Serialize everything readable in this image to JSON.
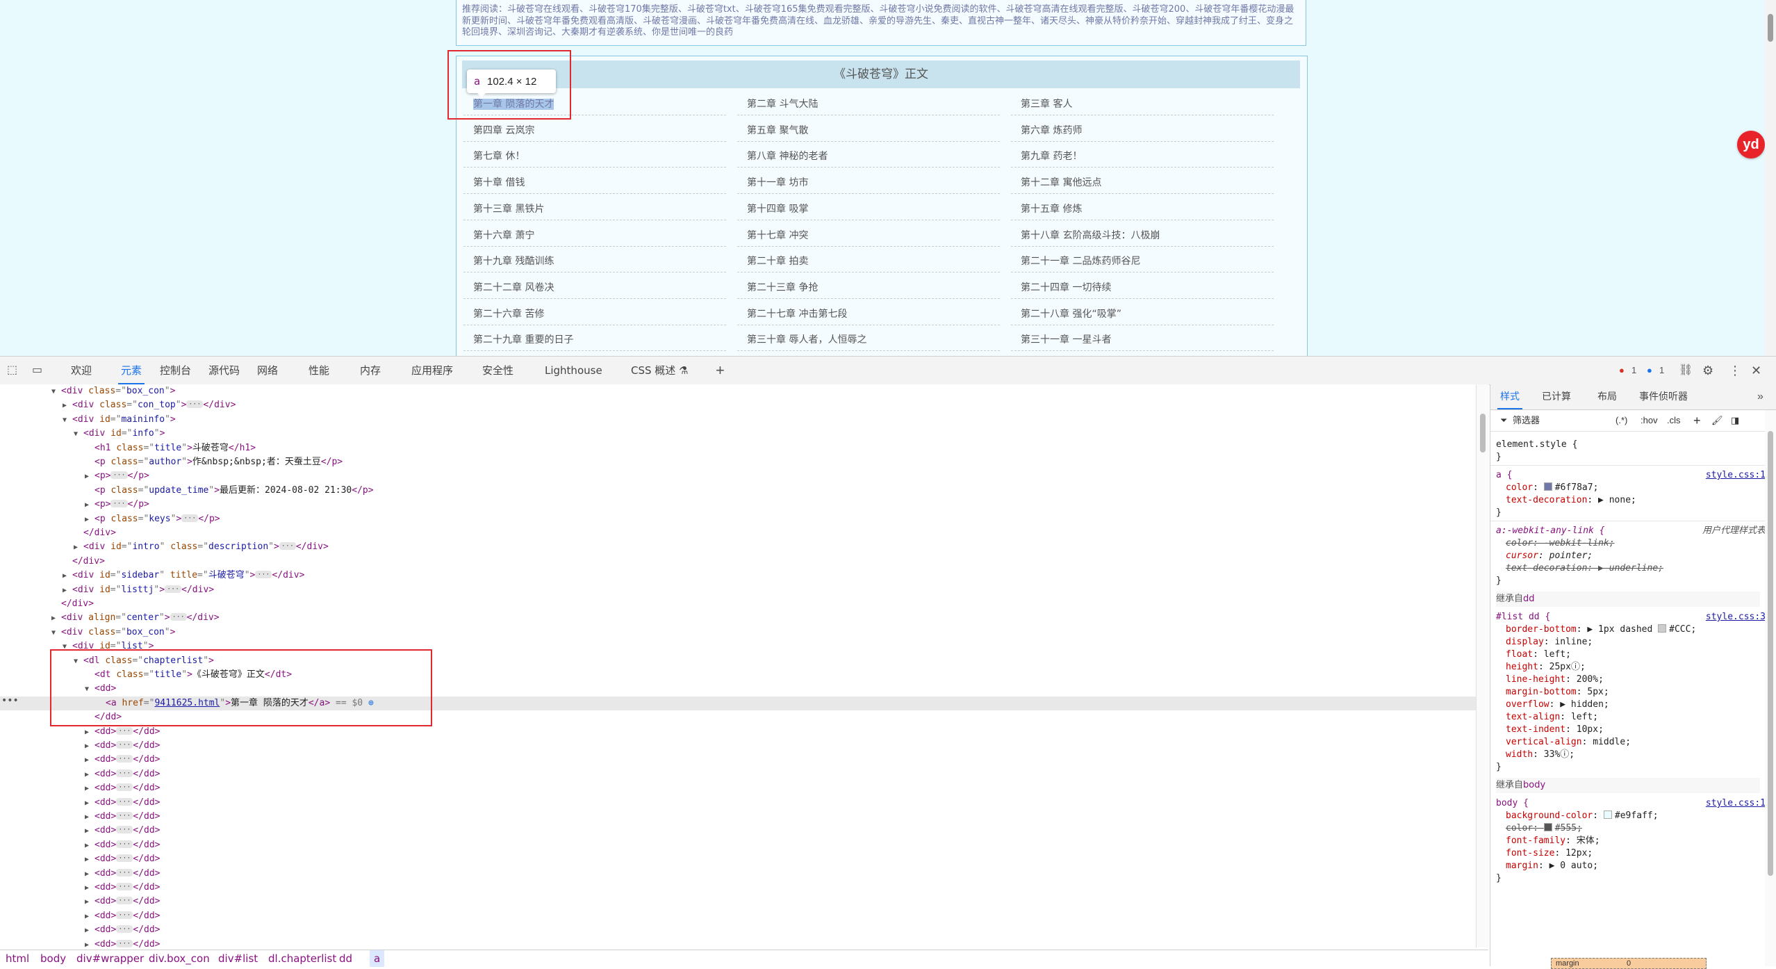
{
  "page": {
    "recommend_text": "推荐阅读：斗破苍穹在线观看、斗破苍穹170集完整版、斗破苍穹txt、斗破苍穹165集免费观看完整版、斗破苍穹小说免费阅读的软件、斗破苍穹高清在线观看完整版、斗破苍穹200、斗破苍穹年番樱花动漫最新更新时间、斗破苍穹年番免费观看高清版、斗破苍穹漫画、斗破苍穹年番免费高清在线、血龙骄雄、亲爱的导游先生、秦吏、直视古神一整年、诸天尽头、神豪从特价矜奈开始、穿越封神我成了纣王、变身之轮回境界、深圳咨询记、大秦期才有逆袭系统、你是世间唯一的良药",
    "list_title": "《斗破苍穹》正文",
    "chapters": [
      "第一章 陨落的天才",
      "第二章 斗气大陆",
      "第三章 客人",
      "第四章 云岚宗",
      "第五章 聚气散",
      "第六章 炼药师",
      "第七章 休！",
      "第八章 神秘的老者",
      "第九章 药老！",
      "第十章 借钱",
      "第十一章 坊市",
      "第十二章 寓他远点",
      "第十三章 黑铁片",
      "第十四章 吸掌",
      "第十五章 修炼",
      "第十六章 萧宁",
      "第十七章 冲突",
      "第十八章 玄阶高级斗技：八极崩",
      "第十九章 残酷训练",
      "第二十章 拍卖",
      "第二十一章 二品炼药师谷尼",
      "第二十二章 风卷决",
      "第二十三章 争抢",
      "第二十四章 一切待续",
      "第二十六章 苦修",
      "第二十七章 冲击第七段",
      "第二十八章 强化“吸掌”",
      "第二十九章 重要的日子",
      "第三十章 辱人者，人恒辱之",
      "第三十一章 一星斗者"
    ],
    "tooltip_tag": "a",
    "tooltip_dims": "102.4 × 12",
    "badge": "yd"
  },
  "devtools": {
    "tabs": [
      "欢迎",
      "元素",
      "控制台",
      "源代码",
      "网络",
      "性能",
      "内存",
      "应用程序",
      "安全性",
      "Lighthouse",
      "CSS 概述 ⚗"
    ],
    "active_tab": "元素",
    "error_count": "1",
    "info_count": "1",
    "dom_lines": [
      {
        "indent": 2,
        "tri": "▼",
        "html": [
          [
            "tg",
            "<div "
          ],
          [
            "an",
            "class"
          ],
          [
            "eq",
            "=\""
          ],
          [
            "av",
            "box_con"
          ],
          [
            "eq",
            "\""
          ],
          [
            "tg",
            ">"
          ]
        ]
      },
      {
        "indent": 3,
        "tri": "▶",
        "html": [
          [
            "tg",
            "<div "
          ],
          [
            "an",
            "class"
          ],
          [
            "eq",
            "=\""
          ],
          [
            "av",
            "con_top"
          ],
          [
            "eq",
            "\""
          ],
          [
            "tg",
            ">"
          ],
          [
            "ell",
            "···"
          ],
          [
            "tg",
            "</div>"
          ]
        ]
      },
      {
        "indent": 3,
        "tri": "▼",
        "html": [
          [
            "tg",
            "<div "
          ],
          [
            "an",
            "id"
          ],
          [
            "eq",
            "=\""
          ],
          [
            "av",
            "maininfo"
          ],
          [
            "eq",
            "\""
          ],
          [
            "tg",
            ">"
          ]
        ]
      },
      {
        "indent": 4,
        "tri": "▼",
        "html": [
          [
            "tg",
            "<div "
          ],
          [
            "an",
            "id"
          ],
          [
            "eq",
            "=\""
          ],
          [
            "av",
            "info"
          ],
          [
            "eq",
            "\""
          ],
          [
            "tg",
            ">"
          ]
        ]
      },
      {
        "indent": 5,
        "tri": "",
        "html": [
          [
            "tg",
            "<h1 "
          ],
          [
            "an",
            "class"
          ],
          [
            "eq",
            "=\""
          ],
          [
            "av",
            "title"
          ],
          [
            "eq",
            "\""
          ],
          [
            "tg",
            ">"
          ],
          [
            "tx",
            "斗破苍穹"
          ],
          [
            "tg",
            "</h1>"
          ]
        ]
      },
      {
        "indent": 5,
        "tri": "",
        "html": [
          [
            "tg",
            "<p "
          ],
          [
            "an",
            "class"
          ],
          [
            "eq",
            "=\""
          ],
          [
            "av",
            "author"
          ],
          [
            "eq",
            "\""
          ],
          [
            "tg",
            ">"
          ],
          [
            "tx",
            "作&nbsp;&nbsp;者：天蚕土豆"
          ],
          [
            "tg",
            "</p>"
          ]
        ]
      },
      {
        "indent": 5,
        "tri": "▶",
        "html": [
          [
            "tg",
            "<p>"
          ],
          [
            "ell",
            "···"
          ],
          [
            "tg",
            "</p>"
          ]
        ]
      },
      {
        "indent": 5,
        "tri": "",
        "html": [
          [
            "tg",
            "<p "
          ],
          [
            "an",
            "class"
          ],
          [
            "eq",
            "=\""
          ],
          [
            "av",
            "update_time"
          ],
          [
            "eq",
            "\""
          ],
          [
            "tg",
            ">"
          ],
          [
            "tx",
            "最后更新：2024-08-02 21:30"
          ],
          [
            "tg",
            "</p>"
          ]
        ]
      },
      {
        "indent": 5,
        "tri": "▶",
        "html": [
          [
            "tg",
            "<p>"
          ],
          [
            "ell",
            "···"
          ],
          [
            "tg",
            "</p>"
          ]
        ]
      },
      {
        "indent": 5,
        "tri": "▶",
        "html": [
          [
            "tg",
            "<p "
          ],
          [
            "an",
            "class"
          ],
          [
            "eq",
            "=\""
          ],
          [
            "av",
            "keys"
          ],
          [
            "eq",
            "\""
          ],
          [
            "tg",
            ">"
          ],
          [
            "ell",
            "···"
          ],
          [
            "tg",
            "</p>"
          ]
        ]
      },
      {
        "indent": 4,
        "tri": "",
        "html": [
          [
            "tg",
            "</div>"
          ]
        ]
      },
      {
        "indent": 4,
        "tri": "▶",
        "html": [
          [
            "tg",
            "<div "
          ],
          [
            "an",
            "id"
          ],
          [
            "eq",
            "=\""
          ],
          [
            "av",
            "intro"
          ],
          [
            "eq",
            "\" "
          ],
          [
            "an",
            "class"
          ],
          [
            "eq",
            "=\""
          ],
          [
            "av",
            "description"
          ],
          [
            "eq",
            "\""
          ],
          [
            "tg",
            ">"
          ],
          [
            "ell",
            "···"
          ],
          [
            "tg",
            "</div>"
          ]
        ]
      },
      {
        "indent": 3,
        "tri": "",
        "html": [
          [
            "tg",
            "</div>"
          ]
        ]
      },
      {
        "indent": 3,
        "tri": "▶",
        "html": [
          [
            "tg",
            "<div "
          ],
          [
            "an",
            "id"
          ],
          [
            "eq",
            "=\""
          ],
          [
            "av",
            "sidebar"
          ],
          [
            "eq",
            "\" "
          ],
          [
            "an",
            "title"
          ],
          [
            "eq",
            "=\""
          ],
          [
            "av",
            "斗破苍穹"
          ],
          [
            "eq",
            "\""
          ],
          [
            "tg",
            ">"
          ],
          [
            "ell",
            "···"
          ],
          [
            "tg",
            "</div>"
          ]
        ]
      },
      {
        "indent": 3,
        "tri": "▶",
        "html": [
          [
            "tg",
            "<div "
          ],
          [
            "an",
            "id"
          ],
          [
            "eq",
            "=\""
          ],
          [
            "av",
            "listtj"
          ],
          [
            "eq",
            "\""
          ],
          [
            "tg",
            ">"
          ],
          [
            "ell",
            "···"
          ],
          [
            "tg",
            "</div>"
          ]
        ]
      },
      {
        "indent": 2,
        "tri": "",
        "html": [
          [
            "tg",
            "</div>"
          ]
        ]
      },
      {
        "indent": 2,
        "tri": "▶",
        "html": [
          [
            "tg",
            "<div "
          ],
          [
            "an",
            "align"
          ],
          [
            "eq",
            "=\""
          ],
          [
            "av",
            "center"
          ],
          [
            "eq",
            "\""
          ],
          [
            "tg",
            ">"
          ],
          [
            "ell",
            "···"
          ],
          [
            "tg",
            "</div>"
          ]
        ]
      },
      {
        "indent": 2,
        "tri": "▼",
        "html": [
          [
            "tg",
            "<div "
          ],
          [
            "an",
            "class"
          ],
          [
            "eq",
            "=\""
          ],
          [
            "av",
            "box_con"
          ],
          [
            "eq",
            "\""
          ],
          [
            "tg",
            ">"
          ]
        ]
      },
      {
        "indent": 3,
        "tri": "▼",
        "html": [
          [
            "tg",
            "<div "
          ],
          [
            "an",
            "id"
          ],
          [
            "eq",
            "=\""
          ],
          [
            "av",
            "list"
          ],
          [
            "eq",
            "\""
          ],
          [
            "tg",
            ">"
          ]
        ]
      },
      {
        "indent": 4,
        "tri": "▼",
        "html": [
          [
            "tg",
            "<dl "
          ],
          [
            "an",
            "class"
          ],
          [
            "eq",
            "=\""
          ],
          [
            "av",
            "chapterlist"
          ],
          [
            "eq",
            "\""
          ],
          [
            "tg",
            ">"
          ]
        ]
      },
      {
        "indent": 5,
        "tri": "",
        "html": [
          [
            "tg",
            "<dt "
          ],
          [
            "an",
            "class"
          ],
          [
            "eq",
            "=\""
          ],
          [
            "av",
            "title"
          ],
          [
            "eq",
            "\""
          ],
          [
            "tg",
            ">"
          ],
          [
            "tx",
            "《斗破苍穹》正文"
          ],
          [
            "tg",
            "</dt>"
          ]
        ]
      },
      {
        "indent": 5,
        "tri": "▼",
        "html": [
          [
            "tg",
            "<dd>"
          ]
        ]
      },
      {
        "indent": 6,
        "tri": "",
        "sel": true,
        "html": [
          [
            "tg",
            "<a "
          ],
          [
            "an",
            "href"
          ],
          [
            "eq",
            "=\""
          ],
          [
            "lk",
            "9411625.html"
          ],
          [
            "eq",
            "\""
          ],
          [
            "tg",
            ">"
          ],
          [
            "tx",
            "第一章 陨落的天才"
          ],
          [
            "tg",
            "</a>"
          ],
          [
            "eq",
            " == $0 "
          ]
        ]
      },
      {
        "indent": 5,
        "tri": "",
        "html": [
          [
            "tg",
            "</dd>"
          ]
        ]
      },
      {
        "indent": 5,
        "tri": "▶",
        "html": [
          [
            "tg",
            "<dd>"
          ],
          [
            "ell",
            "···"
          ],
          [
            "tg",
            "</dd>"
          ]
        ]
      },
      {
        "indent": 5,
        "tri": "▶",
        "html": [
          [
            "tg",
            "<dd>"
          ],
          [
            "ell",
            "···"
          ],
          [
            "tg",
            "</dd>"
          ]
        ]
      },
      {
        "indent": 5,
        "tri": "▶",
        "html": [
          [
            "tg",
            "<dd>"
          ],
          [
            "ell",
            "···"
          ],
          [
            "tg",
            "</dd>"
          ]
        ]
      },
      {
        "indent": 5,
        "tri": "▶",
        "html": [
          [
            "tg",
            "<dd>"
          ],
          [
            "ell",
            "···"
          ],
          [
            "tg",
            "</dd>"
          ]
        ]
      },
      {
        "indent": 5,
        "tri": "▶",
        "html": [
          [
            "tg",
            "<dd>"
          ],
          [
            "ell",
            "···"
          ],
          [
            "tg",
            "</dd>"
          ]
        ]
      },
      {
        "indent": 5,
        "tri": "▶",
        "html": [
          [
            "tg",
            "<dd>"
          ],
          [
            "ell",
            "···"
          ],
          [
            "tg",
            "</dd>"
          ]
        ]
      },
      {
        "indent": 5,
        "tri": "▶",
        "html": [
          [
            "tg",
            "<dd>"
          ],
          [
            "ell",
            "···"
          ],
          [
            "tg",
            "</dd>"
          ]
        ]
      },
      {
        "indent": 5,
        "tri": "▶",
        "html": [
          [
            "tg",
            "<dd>"
          ],
          [
            "ell",
            "···"
          ],
          [
            "tg",
            "</dd>"
          ]
        ]
      },
      {
        "indent": 5,
        "tri": "▶",
        "html": [
          [
            "tg",
            "<dd>"
          ],
          [
            "ell",
            "···"
          ],
          [
            "tg",
            "</dd>"
          ]
        ]
      },
      {
        "indent": 5,
        "tri": "▶",
        "html": [
          [
            "tg",
            "<dd>"
          ],
          [
            "ell",
            "···"
          ],
          [
            "tg",
            "</dd>"
          ]
        ]
      },
      {
        "indent": 5,
        "tri": "▶",
        "html": [
          [
            "tg",
            "<dd>"
          ],
          [
            "ell",
            "···"
          ],
          [
            "tg",
            "</dd>"
          ]
        ]
      },
      {
        "indent": 5,
        "tri": "▶",
        "html": [
          [
            "tg",
            "<dd>"
          ],
          [
            "ell",
            "···"
          ],
          [
            "tg",
            "</dd>"
          ]
        ]
      },
      {
        "indent": 5,
        "tri": "▶",
        "html": [
          [
            "tg",
            "<dd>"
          ],
          [
            "ell",
            "···"
          ],
          [
            "tg",
            "</dd>"
          ]
        ]
      },
      {
        "indent": 5,
        "tri": "▶",
        "html": [
          [
            "tg",
            "<dd>"
          ],
          [
            "ell",
            "···"
          ],
          [
            "tg",
            "</dd>"
          ]
        ]
      },
      {
        "indent": 5,
        "tri": "▶",
        "html": [
          [
            "tg",
            "<dd>"
          ],
          [
            "ell",
            "···"
          ],
          [
            "tg",
            "</dd>"
          ]
        ]
      },
      {
        "indent": 5,
        "tri": "▶",
        "html": [
          [
            "tg",
            "<dd>"
          ],
          [
            "ell",
            "···"
          ],
          [
            "tg",
            "</dd>"
          ]
        ]
      },
      {
        "indent": 5,
        "tri": "▶",
        "html": [
          [
            "tg",
            "<dd>"
          ],
          [
            "ell",
            "···"
          ],
          [
            "tg",
            "</dd>"
          ]
        ]
      }
    ],
    "breadcrumbs": [
      "html",
      "body",
      "div#wrapper",
      "div.box_con",
      "div#list",
      "dl.chapterlist",
      "dd",
      "a"
    ],
    "styles_tabs": [
      "样式",
      "已计算",
      "布局",
      "事件侦听器"
    ],
    "styles_active": "样式",
    "filter_label": "筛选器",
    "filter_hov": ":hov",
    "filter_cls": ".cls",
    "rules": {
      "element_style": "element.style {",
      "a_selector": "a {",
      "a_src": "style.css:1",
      "a_color": "#6f78a7",
      "a_decoration": "none",
      "ua_selector": "a:-webkit-any-link {",
      "ua_label": "用户代理样式表",
      "ua_color": "-webkit-link",
      "ua_cursor": "pointer",
      "ua_decoration": "underline",
      "inherit_dd": "dd",
      "inherit_prefix": "继承自",
      "dd_selector": "#list dd {",
      "dd_src": "style.css:3",
      "dd_props": [
        [
          "border-bottom",
          "▶ 1px dashed ",
          "#CCC"
        ],
        [
          "display",
          "inline",
          ""
        ],
        [
          "float",
          "left",
          ""
        ],
        [
          "height",
          "25px",
          "ⓘ"
        ],
        [
          "line-height",
          "200%",
          ""
        ],
        [
          "margin-bottom",
          "5px",
          ""
        ],
        [
          "overflow",
          "▶ hidden",
          ""
        ],
        [
          "text-align",
          "left",
          ""
        ],
        [
          "text-indent",
          "10px",
          ""
        ],
        [
          "vertical-align",
          "middle",
          ""
        ],
        [
          "width",
          "33%",
          "ⓘ"
        ]
      ],
      "inherit_body": "body",
      "body_selector": "body {",
      "body_src": "style.css:1",
      "body_bg": "#e9faff",
      "body_color": "#555",
      "body_font_family": "宋体",
      "body_font_size": "12px",
      "body_margin": "▶ 0 auto",
      "margin_label": "margin",
      "margin_value": "0"
    }
  }
}
